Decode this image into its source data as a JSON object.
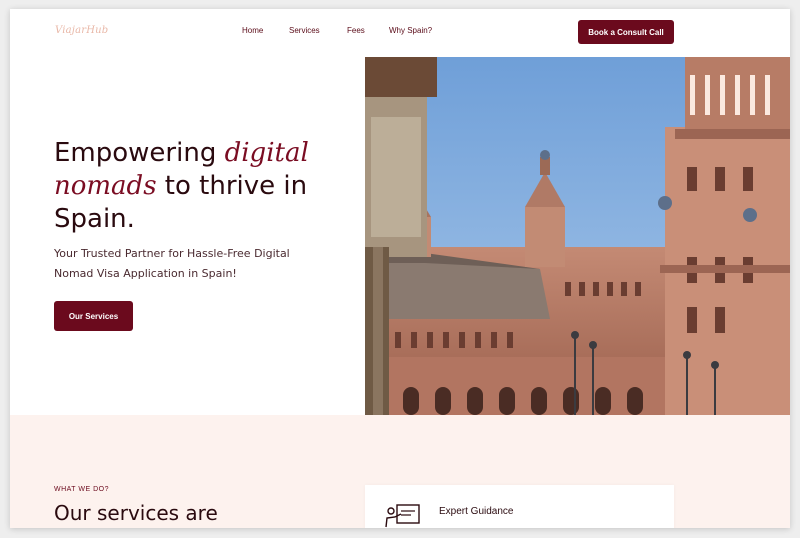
{
  "header": {
    "logo_text": "ViajarHub",
    "nav": [
      "Home",
      "Services",
      "Fees",
      "Why Spain?"
    ],
    "cta_label": "Book a Consult Call"
  },
  "hero": {
    "headline_1": "Empowering ",
    "headline_accent_1": "digital",
    "headline_accent_2": "nomads",
    "headline_2": " to thrive in Spain.",
    "subheading": "Your Trusted Partner for Hassle-Free Digital Nomad Visa Application in Spain!",
    "cta_label": "Our Services",
    "image_icon": "plaza-de-espana-photo"
  },
  "services": {
    "eyebrow": "WHAT WE DO?",
    "title": "Our services are",
    "cards": [
      {
        "title": "Expert Guidance",
        "icon": "presentation-icon"
      }
    ]
  },
  "colors": {
    "brand": "#6b0a1d",
    "accent_text": "#7a0c22",
    "logo": "#e9b8a8",
    "section_bg": "#fdf2ee"
  }
}
